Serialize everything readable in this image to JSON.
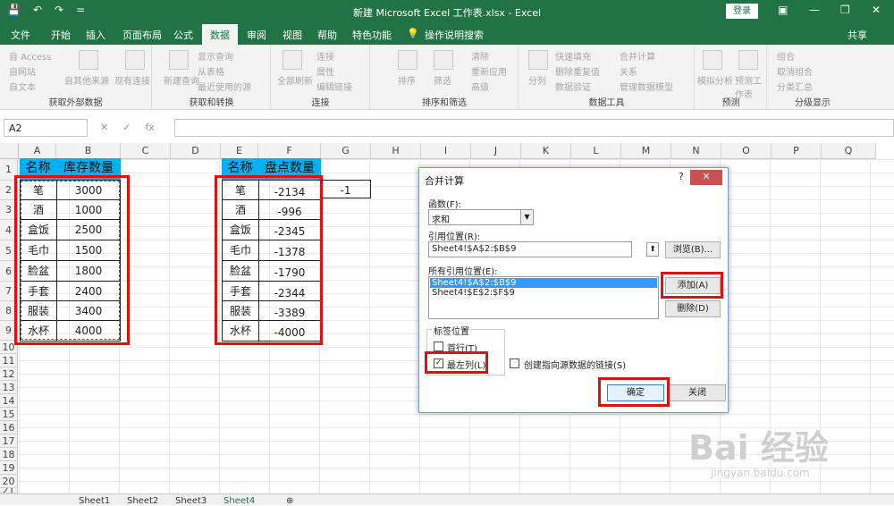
{
  "titlebar": {
    "title": "新建 Microsoft Excel 工作表.xlsx  -  Excel",
    "login": "登录",
    "qat": [
      "💾",
      "↶",
      "↷",
      "="
    ]
  },
  "tabs": [
    "文件",
    "开始",
    "插入",
    "页面布局",
    "公式",
    "数据",
    "审阅",
    "视图",
    "帮助",
    "特色功能",
    "操作说明搜索"
  ],
  "share": "共享",
  "ribbon": {
    "g1": {
      "items": [
        "自 Access",
        "自网站",
        "自文本",
        "自其他来源",
        "现有连接"
      ],
      "label": "获取外部数据"
    },
    "g2": {
      "items": [
        "新建查询",
        "显示查询",
        "从表格",
        "最近使用的源"
      ],
      "label": "获取和转换"
    },
    "g3": {
      "items": [
        "全部刷新",
        "连接",
        "属性",
        "编辑链接"
      ],
      "label": "连接"
    },
    "g4": {
      "items": [
        "排序",
        "筛选",
        "清除",
        "重新应用",
        "高级"
      ],
      "label": "排序和筛选"
    },
    "g5": {
      "items": [
        "分列",
        "快速填充",
        "删除重复值",
        "数据验证",
        "合并计算",
        "关系",
        "管理数据模型"
      ],
      "label": "数据工具"
    },
    "g6": {
      "items": [
        "模拟分析",
        "预测工作表"
      ],
      "label": "预测"
    },
    "g7": {
      "items": [
        "组合",
        "取消组合",
        "分类汇总"
      ],
      "label": "分级显示"
    }
  },
  "formula": {
    "namebox": "A2",
    "fx": "fx"
  },
  "columns": [
    "A",
    "B",
    "C",
    "D",
    "E",
    "F",
    "G",
    "H",
    "I",
    "J",
    "K",
    "L",
    "M",
    "N",
    "O",
    "P",
    "Q"
  ],
  "rows": [
    "1",
    "2",
    "3",
    "4",
    "5",
    "6",
    "7",
    "8",
    "9",
    "10",
    "11",
    "12",
    "13",
    "14",
    "15",
    "16",
    "17",
    "18",
    "19",
    "20",
    "21"
  ],
  "table1": {
    "headers": [
      "名称",
      "库存数量"
    ],
    "rows": [
      [
        "笔",
        "3000"
      ],
      [
        "酒",
        "1000"
      ],
      [
        "盒饭",
        "2500"
      ],
      [
        "毛巾",
        "1500"
      ],
      [
        "脸盆",
        "1800"
      ],
      [
        "手套",
        "2400"
      ],
      [
        "服装",
        "3400"
      ],
      [
        "水杯",
        "4000"
      ]
    ]
  },
  "table2": {
    "headers": [
      "名称",
      "盘点数量"
    ],
    "rows": [
      [
        "笔",
        "-2134"
      ],
      [
        "酒",
        "-996"
      ],
      [
        "盒饭",
        "-2345"
      ],
      [
        "毛巾",
        "-1378"
      ],
      [
        "脸盆",
        "-1790"
      ],
      [
        "手套",
        "-2344"
      ],
      [
        "服装",
        "-3389"
      ],
      [
        "水杯",
        "-4000"
      ]
    ]
  },
  "g2value": "-1",
  "sheets": [
    "Sheet1",
    "Sheet2",
    "Sheet3",
    "Sheet4"
  ],
  "dialog": {
    "title": "合并计算",
    "help": "?",
    "close": "✕",
    "function_label": "函数(F):",
    "function_value": "求和",
    "ref_label": "引用位置(R):",
    "ref_value": "Sheet4!$A$2:$B$9",
    "browse": "浏览(B)...",
    "all_refs_label": "所有引用位置(E):",
    "all_refs": [
      "Sheet4!$A$2:$B$9",
      "Sheet4!$E$2:$F$9"
    ],
    "add": "添加(A)",
    "delete": "删除(D)",
    "label_pos": "标签位置",
    "first_row": "首行(T)",
    "left_col": "最左列(L)",
    "create_links": "创建指向源数据的链接(S)",
    "ok": "确定",
    "close_btn": "关闭"
  },
  "watermark": {
    "main": "Bai 经验",
    "sub": "jingyan.baidu.com"
  }
}
